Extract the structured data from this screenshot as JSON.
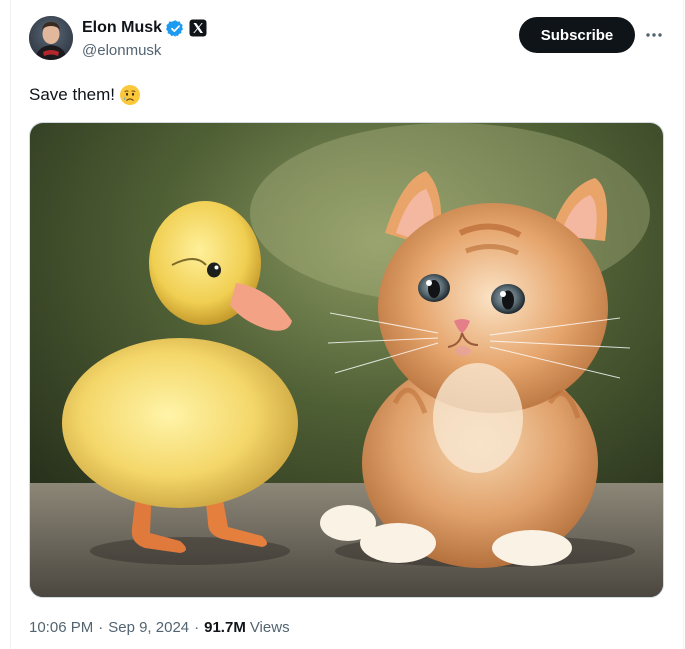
{
  "author": {
    "display_name": "Elon Musk",
    "handle": "@elonmusk",
    "verified_badge_icon": "verified-badge-icon",
    "affiliate_icon": "x-logo-icon"
  },
  "actions": {
    "subscribe_label": "Subscribe",
    "more_icon": "more-icon"
  },
  "tweet": {
    "text": "Save them!",
    "emoji": "😢"
  },
  "media": {
    "icon": "photo-duckling-and-kitten"
  },
  "meta": {
    "time": "10:06 PM",
    "separator": "·",
    "date": "Sep 9, 2024",
    "views_count": "91.7M",
    "views_label": "Views"
  },
  "colors": {
    "text_primary": "#0f1419",
    "text_secondary": "#536471",
    "verified_blue": "#1d9bf0",
    "button_bg": "#0f1419"
  }
}
